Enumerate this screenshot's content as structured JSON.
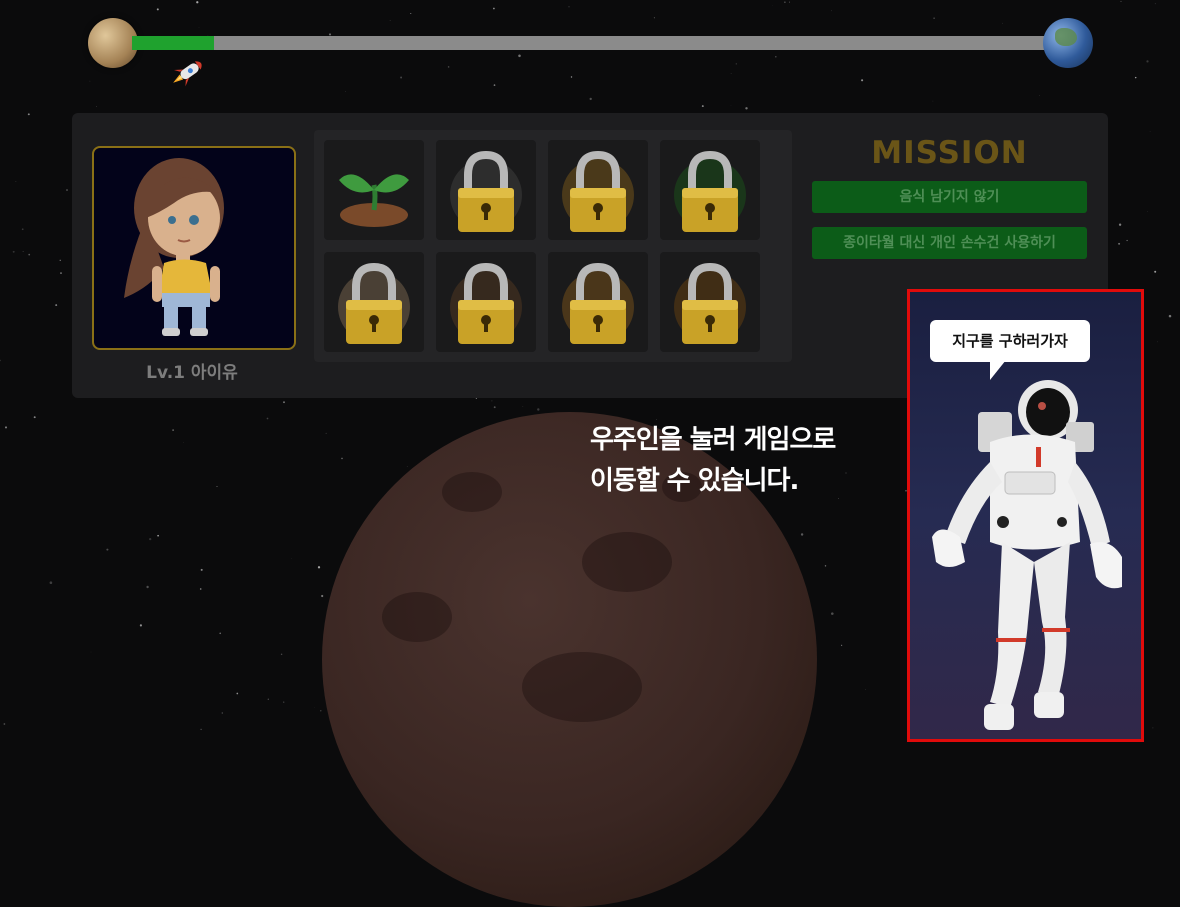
{
  "progress": {
    "value": 0.09,
    "start_planet": "moon-planet-icon",
    "end_planet": "earth-planet-icon",
    "marker": "rocket-icon",
    "fill_color": "#1fa22e",
    "track_color": "#8b8b8b"
  },
  "profile": {
    "level_name": "Lv.1 아이유",
    "avatar": "girl-character-avatar",
    "border_color": "#8a7016"
  },
  "badges": [
    {
      "icon": "sprout-icon",
      "locked": false
    },
    {
      "icon": "padlock-icon",
      "locked": true
    },
    {
      "icon": "padlock-icon",
      "locked": true
    },
    {
      "icon": "padlock-icon",
      "locked": true
    },
    {
      "icon": "padlock-icon",
      "locked": true
    },
    {
      "icon": "padlock-icon",
      "locked": true
    },
    {
      "icon": "padlock-icon",
      "locked": true
    },
    {
      "icon": "padlock-icon",
      "locked": true
    }
  ],
  "mission": {
    "title": "MISSION",
    "items": [
      "음식 남기지 않기",
      "종이타월 대신 개인 손수건 사용하기"
    ]
  },
  "hint": {
    "line1": "우주인을 눌러 게임으로",
    "line2": "이동할 수 있습니다."
  },
  "astronaut": {
    "speech": "지구를 구하러가자",
    "highlight_color": "#e10b0b"
  }
}
